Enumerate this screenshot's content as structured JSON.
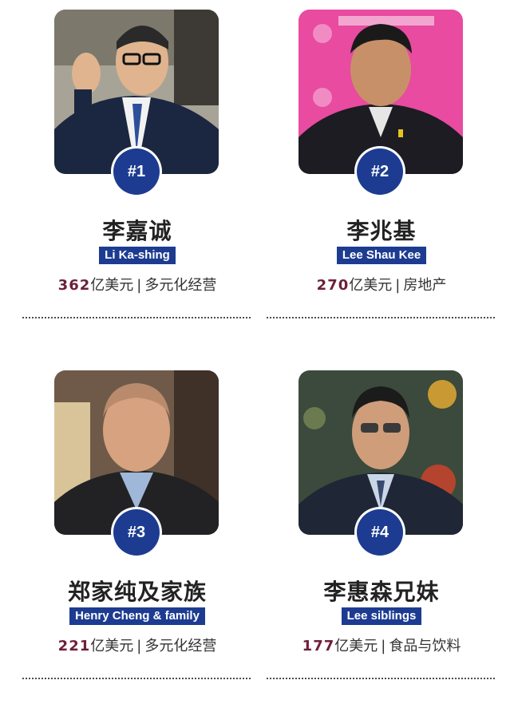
{
  "people": [
    {
      "rank": "#1",
      "name_cn": "李嘉诚",
      "name_en": "Li Ka-shing",
      "amount": "362",
      "unit": "亿美元",
      "separator": "|",
      "industry": "多元化经营",
      "photo_icon": "portrait-li-ka-shing"
    },
    {
      "rank": "#2",
      "name_cn": "李兆基",
      "name_en": "Lee Shau Kee",
      "amount": "270",
      "unit": "亿美元",
      "separator": "|",
      "industry": "房地产",
      "photo_icon": "portrait-lee-shau-kee"
    },
    {
      "rank": "#3",
      "name_cn": "郑家纯及家族",
      "name_en": "Henry Cheng & family",
      "amount": "221",
      "unit": "亿美元",
      "separator": "|",
      "industry": "多元化经营",
      "photo_icon": "portrait-henry-cheng"
    },
    {
      "rank": "#4",
      "name_cn": "李惠森兄妹",
      "name_en": "Lee siblings",
      "amount": "177",
      "unit": "亿美元",
      "separator": "|",
      "industry": "食品与饮料",
      "photo_icon": "portrait-lee-siblings"
    }
  ],
  "colors": {
    "badge_blue": "#1d3c91",
    "amount_color": "#6e1f3a",
    "background": "#ffffff"
  }
}
